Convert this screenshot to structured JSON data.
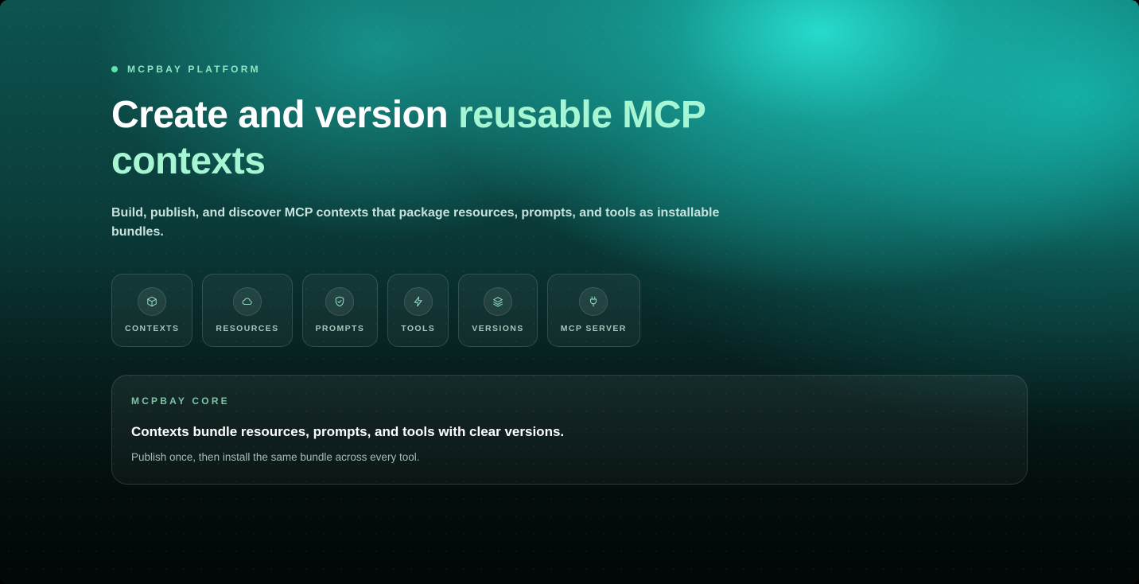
{
  "hero": {
    "eyebrow": "MCPBAY PLATFORM",
    "title_plain": "Create and version ",
    "title_accent": "reusable MCP contexts",
    "subtitle": "Build, publish, and discover MCP contexts that package resources, prompts, and tools as installable bundles."
  },
  "chips": [
    {
      "label": "CONTEXTS",
      "icon": "cube-icon"
    },
    {
      "label": "RESOURCES",
      "icon": "cloud-icon"
    },
    {
      "label": "PROMPTS",
      "icon": "shield-check-icon"
    },
    {
      "label": "TOOLS",
      "icon": "lightning-icon"
    },
    {
      "label": "VERSIONS",
      "icon": "layers-icon"
    },
    {
      "label": "MCP SERVER",
      "icon": "plug-icon"
    }
  ],
  "core": {
    "eyebrow": "MCPBAY CORE",
    "heading": "Contexts bundle resources, prompts, and tools with clear versions.",
    "body": "Publish once, then install the same bundle across every tool."
  },
  "colors": {
    "accent": "#a6f5d3",
    "eyebrow": "#8ee6c4",
    "dot": "#5fe3ad"
  }
}
